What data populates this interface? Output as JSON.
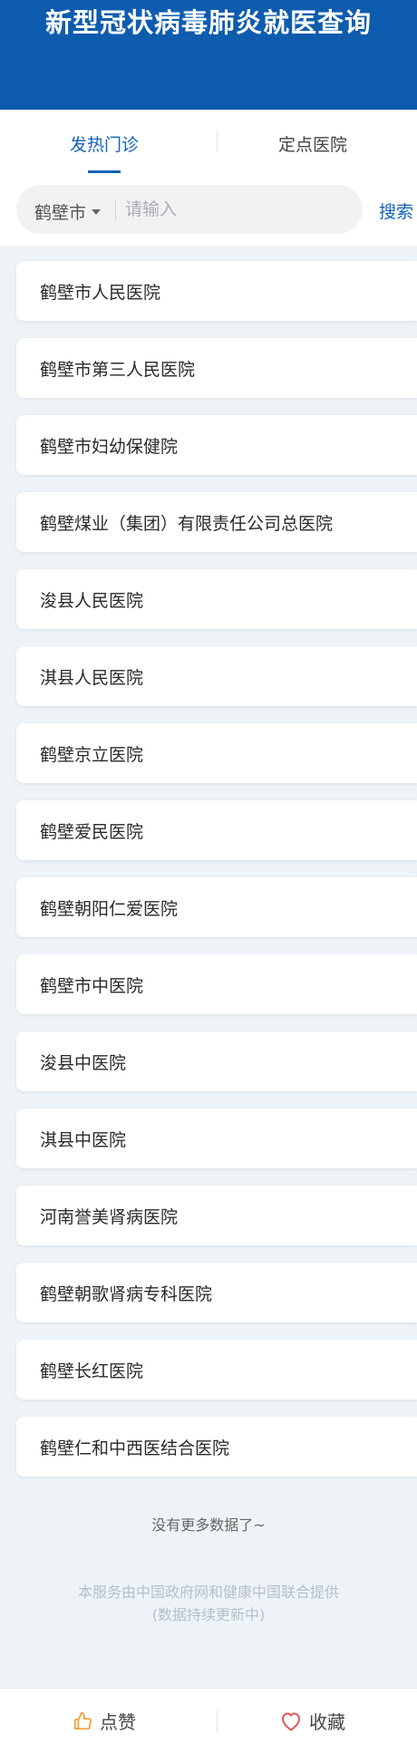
{
  "header": {
    "title": "新型冠状病毒肺炎就医查询"
  },
  "tabs": [
    {
      "label": "发热门诊",
      "active": true
    },
    {
      "label": "定点医院",
      "active": false
    }
  ],
  "search": {
    "city": "鹤壁市",
    "placeholder": "请输入",
    "value": "",
    "button": "搜索"
  },
  "hospitals": [
    "鹤壁市人民医院",
    "鹤壁市第三人民医院",
    "鹤壁市妇幼保健院",
    "鹤壁煤业（集团）有限责任公司总医院",
    "浚县人民医院",
    "淇县人民医院",
    "鹤壁京立医院",
    "鹤壁爱民医院",
    "鹤壁朝阳仁爱医院",
    "鹤壁市中医院",
    "浚县中医院",
    "淇县中医院",
    "河南誉美肾病医院",
    "鹤壁朝歌肾病专科医院",
    "鹤壁长红医院",
    "鹤壁仁和中西医结合医院"
  ],
  "list_end": "没有更多数据了~",
  "footer": {
    "line1": "本服务由中国政府网和健康中国联合提供",
    "line2": "(数据持续更新中)"
  },
  "bottom_bar": {
    "like_label": "点赞",
    "favorite_label": "收藏"
  },
  "colors": {
    "header_bg": "#0e5cae",
    "accent": "#1463b7",
    "like_icon": "#f0a23a",
    "favorite_icon": "#e0575b"
  },
  "icons": {
    "like": "thumbs-up-icon",
    "favorite": "heart-icon",
    "dropdown": "caret-down-icon"
  }
}
